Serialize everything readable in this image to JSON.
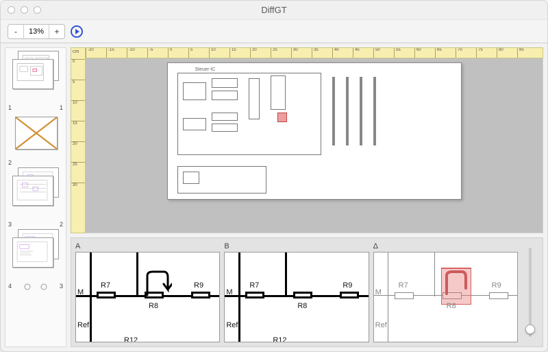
{
  "window": {
    "title": "DiffGT"
  },
  "toolbar": {
    "zoom_out": "-",
    "zoom_value": "13%",
    "zoom_in": "+"
  },
  "ruler": {
    "unit": "cm",
    "h_ticks": [
      "-20",
      "-15",
      "-10",
      "-5",
      "0",
      "5",
      "10",
      "15",
      "20",
      "25",
      "30",
      "35",
      "40",
      "45",
      "50",
      "55",
      "60",
      "65",
      "70",
      "75",
      "80",
      "85"
    ],
    "v_ticks": [
      "0",
      "5",
      "10",
      "15",
      "20",
      "25",
      "30"
    ]
  },
  "sidebar": {
    "pairs": [
      {
        "left": "1",
        "right": "1"
      },
      {
        "left": "2",
        "right": ""
      },
      {
        "left": "3",
        "right": "2"
      },
      {
        "left": "4",
        "right": "3"
      }
    ]
  },
  "page": {
    "block_title": "Steuer-IC"
  },
  "details": {
    "panels": [
      {
        "label": "A"
      },
      {
        "label": "B"
      },
      {
        "label": "Δ"
      }
    ],
    "refs": {
      "m": "M",
      "r7": "R7",
      "r8": "R8",
      "r9": "R9",
      "ref": "Ref",
      "r12": "R12"
    }
  }
}
